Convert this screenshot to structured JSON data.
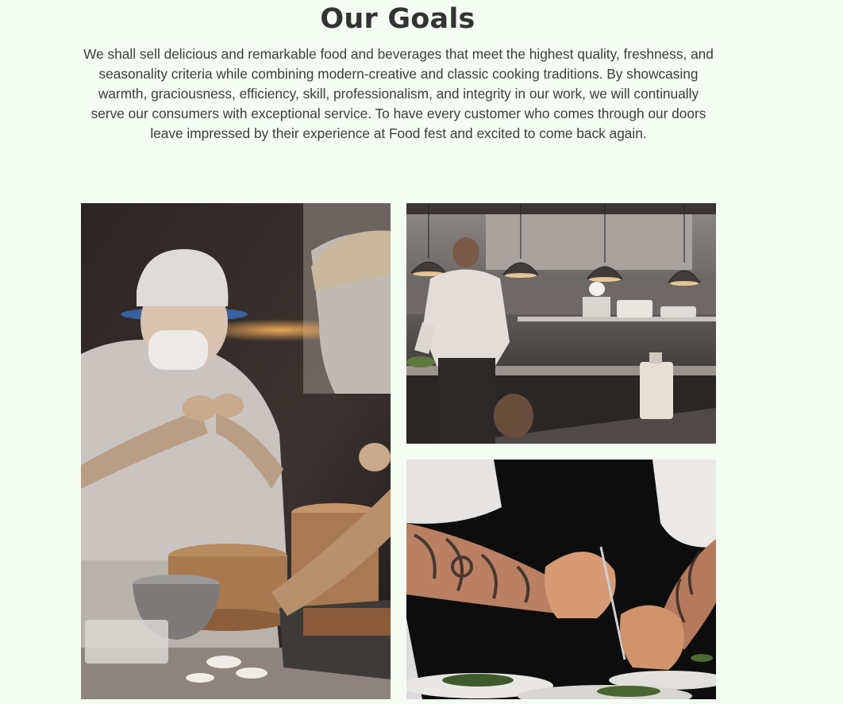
{
  "goals": {
    "title": "Our Goals",
    "body": "We shall sell delicious and remarkable food and beverages that meet the highest quality, freshness, and seasonality criteria while combining modern-creative and classic cooking traditions. By showcasing warmth, graciousness, efficiency, skill, professionalism, and integrity in our work, we will continually serve our consumers with exceptional service. To have every customer who comes through our doors leave impressed by their experience at Food fest and excited to come back again."
  },
  "gallery": {
    "images": [
      {
        "name": "chefs-making-dumplings-photo"
      },
      {
        "name": "restaurant-kitchen-photo"
      },
      {
        "name": "tattooed-chef-plating-photo"
      }
    ]
  },
  "colors": {
    "background": "#f4fcf3",
    "heading": "#333333",
    "body_text": "#3d3d3d"
  }
}
